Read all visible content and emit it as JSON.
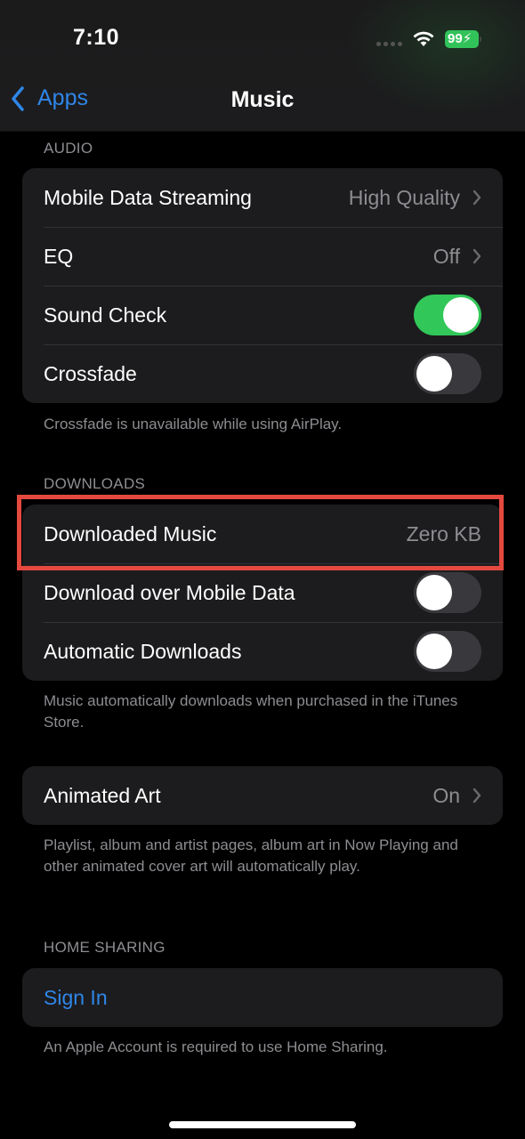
{
  "status_bar": {
    "time": "7:10",
    "battery": "99",
    "battery_color": "#32c25a",
    "charging": true
  },
  "nav": {
    "back_label": "Apps",
    "title": "Music"
  },
  "sections": {
    "audio": {
      "header": "AUDIO",
      "rows": [
        {
          "label": "Mobile Data Streaming",
          "value": "High Quality"
        },
        {
          "label": "EQ",
          "value": "Off"
        },
        {
          "label": "Sound Check",
          "toggle": true
        },
        {
          "label": "Crossfade",
          "toggle": false
        }
      ],
      "footer": "Crossfade is unavailable while using AirPlay."
    },
    "downloads": {
      "header": "DOWNLOADS",
      "rows": [
        {
          "label": "Downloaded Music",
          "value": "Zero KB",
          "highlighted": true
        },
        {
          "label": "Download over Mobile Data",
          "toggle": false
        },
        {
          "label": "Automatic Downloads",
          "toggle": false
        }
      ],
      "footer": "Music automatically downloads when purchased in the iTunes Store."
    },
    "animated_art": {
      "rows": [
        {
          "label": "Animated Art",
          "value": "On"
        }
      ],
      "footer": "Playlist, album and artist pages, album art in Now Playing and other animated cover art will automatically play."
    },
    "home_sharing": {
      "header": "HOME SHARING",
      "rows": [
        {
          "label": "Sign In"
        }
      ],
      "footer": "An Apple Account is required to use Home Sharing."
    }
  },
  "colors": {
    "accent": "#2f86e8",
    "toggle_on": "#32c759",
    "highlight": "#e4493f"
  }
}
